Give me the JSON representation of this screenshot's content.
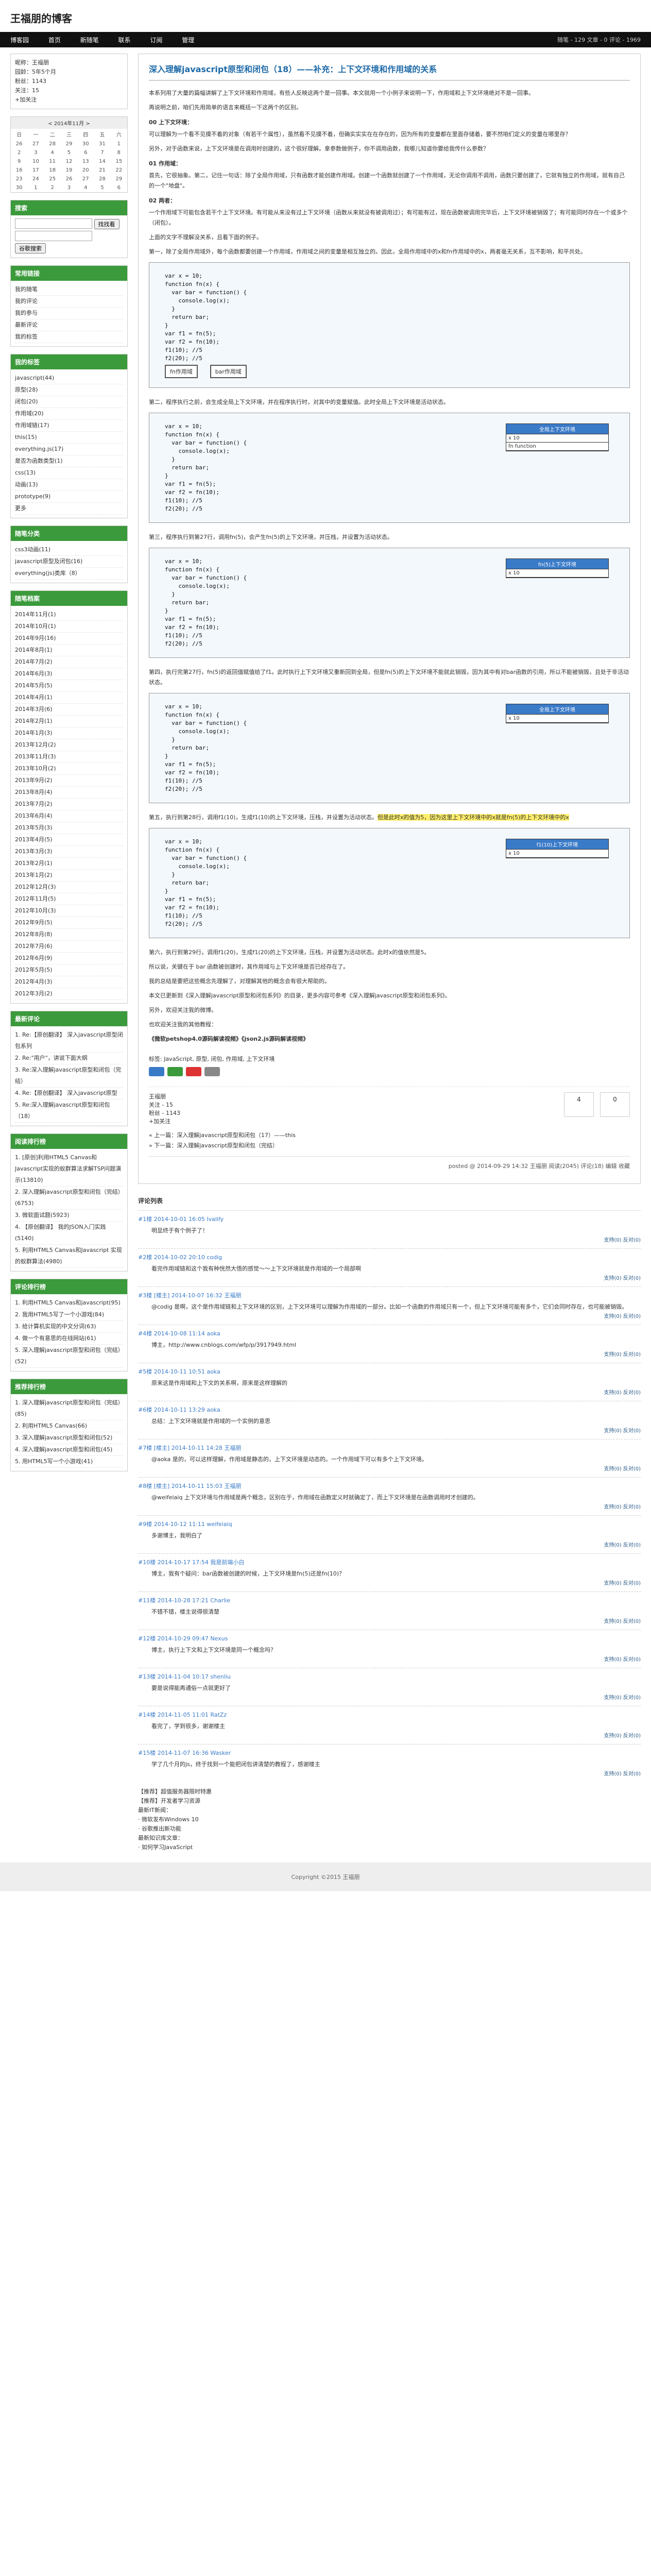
{
  "site": {
    "title": "王福朋的博客"
  },
  "nav": {
    "items": [
      "博客园",
      "首页",
      "新随笔",
      "联系",
      "订阅",
      "管理"
    ],
    "stats": "随笔 - 129  文章 - 0  评论 - 1969"
  },
  "profile": {
    "lines": [
      "昵称：王福朋",
      "园龄：5年5个月",
      "粉丝：1143",
      "关注：15",
      "+加关注"
    ]
  },
  "calendar": {
    "caption": "< 2014年11月 >",
    "weekdays": [
      "日",
      "一",
      "二",
      "三",
      "四",
      "五",
      "六"
    ],
    "rows": [
      [
        "26",
        "27",
        "28",
        "29",
        "30",
        "31",
        "1"
      ],
      [
        "2",
        "3",
        "4",
        "5",
        "6",
        "7",
        "8"
      ],
      [
        "9",
        "10",
        "11",
        "12",
        "13",
        "14",
        "15"
      ],
      [
        "16",
        "17",
        "18",
        "19",
        "20",
        "21",
        "22"
      ],
      [
        "23",
        "24",
        "25",
        "26",
        "27",
        "28",
        "29"
      ],
      [
        "30",
        "1",
        "2",
        "3",
        "4",
        "5",
        "6"
      ]
    ]
  },
  "search": {
    "title": "搜索",
    "btn1": "找找看",
    "btn2": "谷歌搜索"
  },
  "common_links": {
    "title": "常用链接",
    "items": [
      "我的随笔",
      "我的评论",
      "我的参与",
      "最新评论",
      "我的标签"
    ]
  },
  "my_tags": {
    "title": "我的标签",
    "items": [
      "javascript(44)",
      "原型(28)",
      "闭包(20)",
      "作用域(20)",
      "作用域链(17)",
      "this(15)",
      "everything.js(17)",
      "是否为函数类型(1)",
      "css(13)",
      "动画(13)",
      "prototype(9)",
      "更多"
    ]
  },
  "categories": {
    "title": "随笔分类",
    "items": [
      "css3动画(11)",
      "javascript原型及闭包(16)",
      "everything(js)类库（8）"
    ]
  },
  "archive": {
    "title": "随笔档案",
    "items": [
      "2014年11月(1)",
      "2014年10月(1)",
      "2014年9月(16)",
      "2014年8月(1)",
      "2014年7月(2)",
      "2014年6月(3)",
      "2014年5月(5)",
      "2014年4月(1)",
      "2014年3月(6)",
      "2014年2月(1)",
      "2014年1月(3)",
      "2013年12月(2)",
      "2013年11月(3)",
      "2013年10月(2)",
      "2013年9月(2)",
      "2013年8月(4)",
      "2013年7月(2)",
      "2013年6月(4)",
      "2013年5月(3)",
      "2013年4月(5)",
      "2013年3月(3)",
      "2013年2月(1)",
      "2013年1月(2)",
      "2012年12月(3)",
      "2012年11月(5)",
      "2012年10月(3)",
      "2012年9月(5)",
      "2012年8月(8)",
      "2012年7月(6)",
      "2012年6月(9)",
      "2012年5月(5)",
      "2012年4月(3)",
      "2012年3月(2)"
    ]
  },
  "recent_comments": {
    "title": "最新评论",
    "items": [
      "1. Re:【原创翻译】 深入javascript原型闭包系列",
      "2. Re:\"用户\"，讲说下面大纲",
      "3. Re:深入理解javascript原型和闭包（完结）",
      "4. Re:【原创翻译】 深入javascript原型",
      "5. Re:深入理解javascript原型和闭包（18）"
    ]
  },
  "reading_rank": {
    "title": "阅读排行榜",
    "items": [
      "1. [原创]利用HTML5 Canvas和Javascript实现的蚁群算法求解TSP问题演示(13810)",
      "2. 深入理解javascript原型和闭包（完结）(6753)",
      "3. 微软面试题(5923)",
      "4. 【原创翻译】 我的JSON入门实践(5140)",
      "5. 利用HTML5 Canvas和Javascript 实现的蚁群算法(4980)"
    ]
  },
  "comment_rank": {
    "title": "评论排行榜",
    "items": [
      "1. 利用HTML5 Canvas和javascript(95)",
      "2. 我用HTML5写了一个小游戏(84)",
      "3. 给计算机实现的中文分词(63)",
      "4. 做一个有意思的在线网站(61)",
      "5. 深入理解javascript原型和闭包（完结）(52)"
    ]
  },
  "recommend_rank": {
    "title": "推荐排行榜",
    "items": [
      "1. 深入理解javascript原型和闭包（完结）(85)",
      "2. 利用HTML5 Canvas(66)",
      "3. 深入理解javascript原型和闭包(52)",
      "4. 深入理解javascript原型和闭包(45)",
      "5. 用HTML5写一个小游戏(41)"
    ]
  },
  "post": {
    "title": "深入理解javascript原型和闭包（18）——补充：上下文环境和作用域的关系",
    "p1": "本系列用了大量的篇幅讲解了上下文环境和作用域，有些人反映这两个是一回事。本文就用一个小例子来说明一下，作用域和上下文环境绝对不是一回事。",
    "p2": "再说明之前，咱们先用简单的语言来概括一下这两个的区别。",
    "h1": "00 上下文环境：",
    "p3": "可以理解为一个看不见摸不着的对象（有若干个属性），虽然看不见摸不着，但确实实实在在存在的，因为所有的变量都在里面存储着，要不然咱们定义的变量在哪里存？",
    "p4": "另外，对于函数来说，上下文环境是在调用时创建的，这个很好理解。拿参数做例子，你不调用函数，我哪儿知道你要给我传什么参数？",
    "h2": "01 作用域：",
    "p5": "首先，它很抽象。第二，记住一句话：除了全局作用域，只有函数才能创建作用域。创建一个函数就创建了一个作用域，无论你调用不调用，函数只要创建了，它就有独立的作用域，就有自己的一个\"地盘\"。",
    "h3": "02 两者：",
    "p6": "一个作用域下可能包含若干个上下文环境。有可能从来没有过上下文环境（函数从来就没有被调用过）；有可能有过，现在函数被调用完毕后，上下文环境被销毁了；有可能同时存在一个或多个（闭包）。",
    "p7": "上面的文字不理解没关系，且看下面的例子。",
    "p8": "第一，除了全局作用域外，每个函数都要创建一个作用域，作用域之间的变量是相互独立的。因此，全局作用域中的x和fn作用域中的x，两者毫无关系，互不影响，和平共处。",
    "p9": "第二，程序执行之前，会生成全局上下文环境，并在程序执行时，对其中的变量赋值。此时全局上下文环境是活动状态。",
    "p10": "第三，程序执行到第27行，调用fn(5)，会产生fn(5)的上下文环境，并压栈，并设置为活动状态。",
    "p11": "第四，执行完第27行，fn(5)的返回值赋值给了f1。此时执行上下文环境又重新回到全局，但是fn(5)的上下文环境不能就此销毁，因为其中有对bar函数的引用，所以不能被销毁，且处于非活动状态。",
    "p12a": "第五，执行到第28行，调用f1(10)，生成f1(10)的上下文环境，压栈，并设置为活动状态。",
    "p12b": "但是此时x的值为5，因为这里上下文环境中的x就是fn(5)的上下文环境中的x",
    "p13": "第六，执行到第29行，调用f1(20)，生成f1(20)的上下文环境，压栈，并设置为活动状态。此时x的值依然是5。",
    "p14": "所以说，关键在于 bar 函数被创建时，其作用域与上下文环境是否已经存在了。",
    "p15": "我的总结是要把这些概念先理解了，对理解其他的概念会有很大帮助的。",
    "p16": "本文已更新到《深入理解javascript原型和闭包系列》的目录，更多内容可参考《深入理解javascript原型和闭包系列》。",
    "p17": "另外，欢迎关注我的微博。",
    "p18": "也欢迎关注我的其他教程：",
    "p19": "《微软petshop4.0源码解读视频》《json2.js源码解读视频》",
    "tags": "标签: JavaScript, 原型, 闭包, 作用域, 上下文环境",
    "author_name": "王福朋",
    "author_follow": "关注 - 15",
    "author_fans": "粉丝 - 1143",
    "add_follow": "+加关注",
    "up_count": "4",
    "down_count": "0",
    "prev": "« 上一篇：深入理解javascript原型和闭包（17）——this",
    "next": "» 下一篇：深入理解javascript原型和闭包（完结）",
    "footer": "posted @ 2014-09-29 14:32 王福朋 阅读(2045) 评论(18) 编辑 收藏"
  },
  "code": {
    "lines": [
      "var x = 10;",
      "function fn(x) {",
      "  var bar = function() {",
      "    console.log(x);",
      "  }",
      "  return bar;",
      "}",
      "var f1 = fn(5);",
      "var f2 = fn(10);",
      "f1(10); //5",
      "f2(20); //5"
    ],
    "global_ctx": "全局上下文环境",
    "fn_scope": "fn作用域",
    "bar_scope": "bar作用域",
    "fn5_ctx": "fn(5)上下文环境",
    "f110_ctx": "f1(10)上下文环境",
    "x_val": "x 10",
    "fn_val": "fn function"
  },
  "comments": {
    "title": "评论列表",
    "items": [
      {
        "meta": "#1楼 2014-10-01 16:05 Ivalify",
        "text": "明显终于有个例子了！",
        "act": "支持(0) 反对(0)"
      },
      {
        "meta": "#2楼 2014-10-02 20:10 codig",
        "text": "看完作用域链和这个我有种恍然大悟的感觉～～上下文环境就是作用域的一个局部啊",
        "act": "支持(0) 反对(0)"
      },
      {
        "meta": "#3楼 [楼主] 2014-10-07 16:32 王福朋",
        "text": "@codig 是啊，这个是作用域链和上下文环境的区别，上下文环境可以理解为作用域的一部分。比如一个函数的作用域只有一个，但上下文环境可能有多个，它们会同时存在，也可能被销毁。",
        "act": "支持(0) 反对(0)"
      },
      {
        "meta": "#4楼 2014-10-08 11:14 aoka",
        "text": "博主，http://www.cnblogs.com/wfp/p/3917949.html",
        "act": "支持(0) 反对(0)"
      },
      {
        "meta": "#5楼 2014-10-11 10:51 aoka",
        "text": "原来这是作用域和上下文的关系啊，原来是这样理解的",
        "act": "支持(0) 反对(0)"
      },
      {
        "meta": "#6楼 2014-10-11 13:29 aoka",
        "text": "总结：上下文环境就是作用域的一个实例的意思",
        "act": "支持(0) 反对(0)"
      },
      {
        "meta": "#7楼 [楼主] 2014-10-11 14:28 王福朋",
        "text": "@aoka 是的，可以这样理解，作用域是静态的，上下文环境是动态的。一个作用域下可以有多个上下文环境。",
        "act": "支持(0) 反对(0)"
      },
      {
        "meta": "#8楼 [楼主] 2014-10-11 15:03 王福朋",
        "text": "@weifeiaiq 上下文环境与作用域是两个概念，区别在于，作用域在函数定义时就确定了，而上下文环境是在函数调用时才创建的。",
        "act": "支持(0) 反对(0)"
      },
      {
        "meta": "#9楼 2014-10-12 11:11 weifeiaiq",
        "text": "多谢博主，我明白了",
        "act": "支持(0) 反对(0)"
      },
      {
        "meta": "#10楼 2014-10-17 17:54 我是前端小白",
        "text": "博主，我有个疑问：bar函数被创建的时候，上下文环境是fn(5)还是fn(10)？",
        "act": "支持(0) 反对(0)"
      },
      {
        "meta": "#11楼 2014-10-28 17:21 Charlie",
        "text": "不错不错，楼主说得很清楚",
        "act": "支持(0) 反对(0)"
      },
      {
        "meta": "#12楼 2014-10-29 09:47 Nexus",
        "text": "博主，执行上下文和上下文环境是同一个概念吗？",
        "act": "支持(0) 反对(0)"
      },
      {
        "meta": "#13楼 2014-11-04 10:17 shenliu",
        "text": "要是说得能再通俗一点就更好了",
        "act": "支持(0) 反对(0)"
      },
      {
        "meta": "#14楼 2014-11-05 11:01 RatZz",
        "text": "看完了，学到很多，谢谢楼主",
        "act": "支持(0) 反对(0)"
      },
      {
        "meta": "#15楼 2014-11-07 16:36 Wasker",
        "text": "学了几个月的js，终于找到一个能把闭包讲清楚的教程了，感谢楼主",
        "act": "支持(0) 反对(0)"
      }
    ]
  },
  "footer_links": {
    "items": [
      "【推荐】超值服务器限时特惠",
      "【推荐】开发者学习资源",
      "最新IT新闻：",
      "· 微软发布Windows 10",
      "· 谷歌推出新功能",
      "最新知识库文章：",
      "· 如何学习JavaScript"
    ]
  },
  "copyright": "Copyright ©2015 王福朋"
}
